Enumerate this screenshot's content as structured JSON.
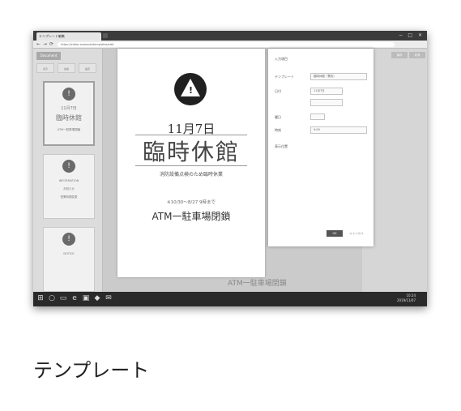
{
  "browser": {
    "tab_title": "テンプレート編集",
    "url": "https://editor.example/templates/edit",
    "window_controls": [
      "−",
      "□",
      "✕"
    ],
    "nav_glyphs": [
      "←",
      "→",
      "⟳"
    ]
  },
  "left_panel": {
    "logo": "Document",
    "tools": [
      "表示",
      "追加",
      "設定"
    ],
    "thumbnails": [
      {
        "lines": [
          "11月7日",
          "臨時休館",
          "ATM一駐車場閉鎖"
        ]
      },
      {
        "lines": [
          "INFORMATION",
          "お知らせ",
          "営業時間変更"
        ]
      },
      {
        "lines": [
          "NOTICE"
        ]
      }
    ]
  },
  "right_strip": {
    "buttons": [
      "保存",
      "共有"
    ]
  },
  "sheet": {
    "date": "11月7日",
    "title": "臨時休館",
    "subtitle": "消防設備点検のため臨時休業",
    "note": "※10/30〜8/27 9時まで",
    "location": "ATM一駐車場閉鎖"
  },
  "dialog": {
    "fields": [
      {
        "label": "入力項目",
        "value": ""
      },
      {
        "label": "テンプレート",
        "value": "臨時休館（警告）"
      },
      {
        "label": "日付",
        "value": "11月7日"
      },
      {
        "label": "曜日",
        "value": "木"
      },
      {
        "label": "時刻",
        "value": "9:00"
      },
      {
        "label": "表示位置",
        "value": "中央"
      }
    ],
    "ok_label": "OK",
    "cancel_label": "キャンセル"
  },
  "background_text": "ATM一駐車場閉鎖",
  "taskbar": {
    "icons": [
      "⊞",
      "○",
      "▭",
      "e",
      "▣",
      "◆",
      "✉"
    ],
    "clock_time": "10:24",
    "clock_date": "2019/11/07"
  },
  "caption": "テンプレート"
}
